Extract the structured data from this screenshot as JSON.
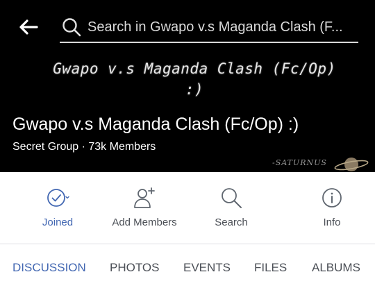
{
  "search": {
    "placeholder": "Search in Gwapo v.s Maganda Clash (F..."
  },
  "cover": {
    "title_line1": "Gwapo v.s Maganda Clash (Fc/Op)",
    "title_line2": ":)",
    "watermark": "-SATURNUS"
  },
  "group": {
    "name": "Gwapo v.s Maganda Clash (Fc/Op) :)",
    "meta": "Secret Group · 73k Members"
  },
  "actions": {
    "joined": "Joined",
    "add_members": "Add Members",
    "search": "Search",
    "info": "Info"
  },
  "tabs": {
    "discussion": "DISCUSSION",
    "photos": "PHOTOS",
    "events": "EVENTS",
    "files": "FILES",
    "albums": "ALBUMS"
  },
  "colors": {
    "accent": "#4267b2",
    "icon_gray": "#606770",
    "header_bg": "#000000"
  }
}
